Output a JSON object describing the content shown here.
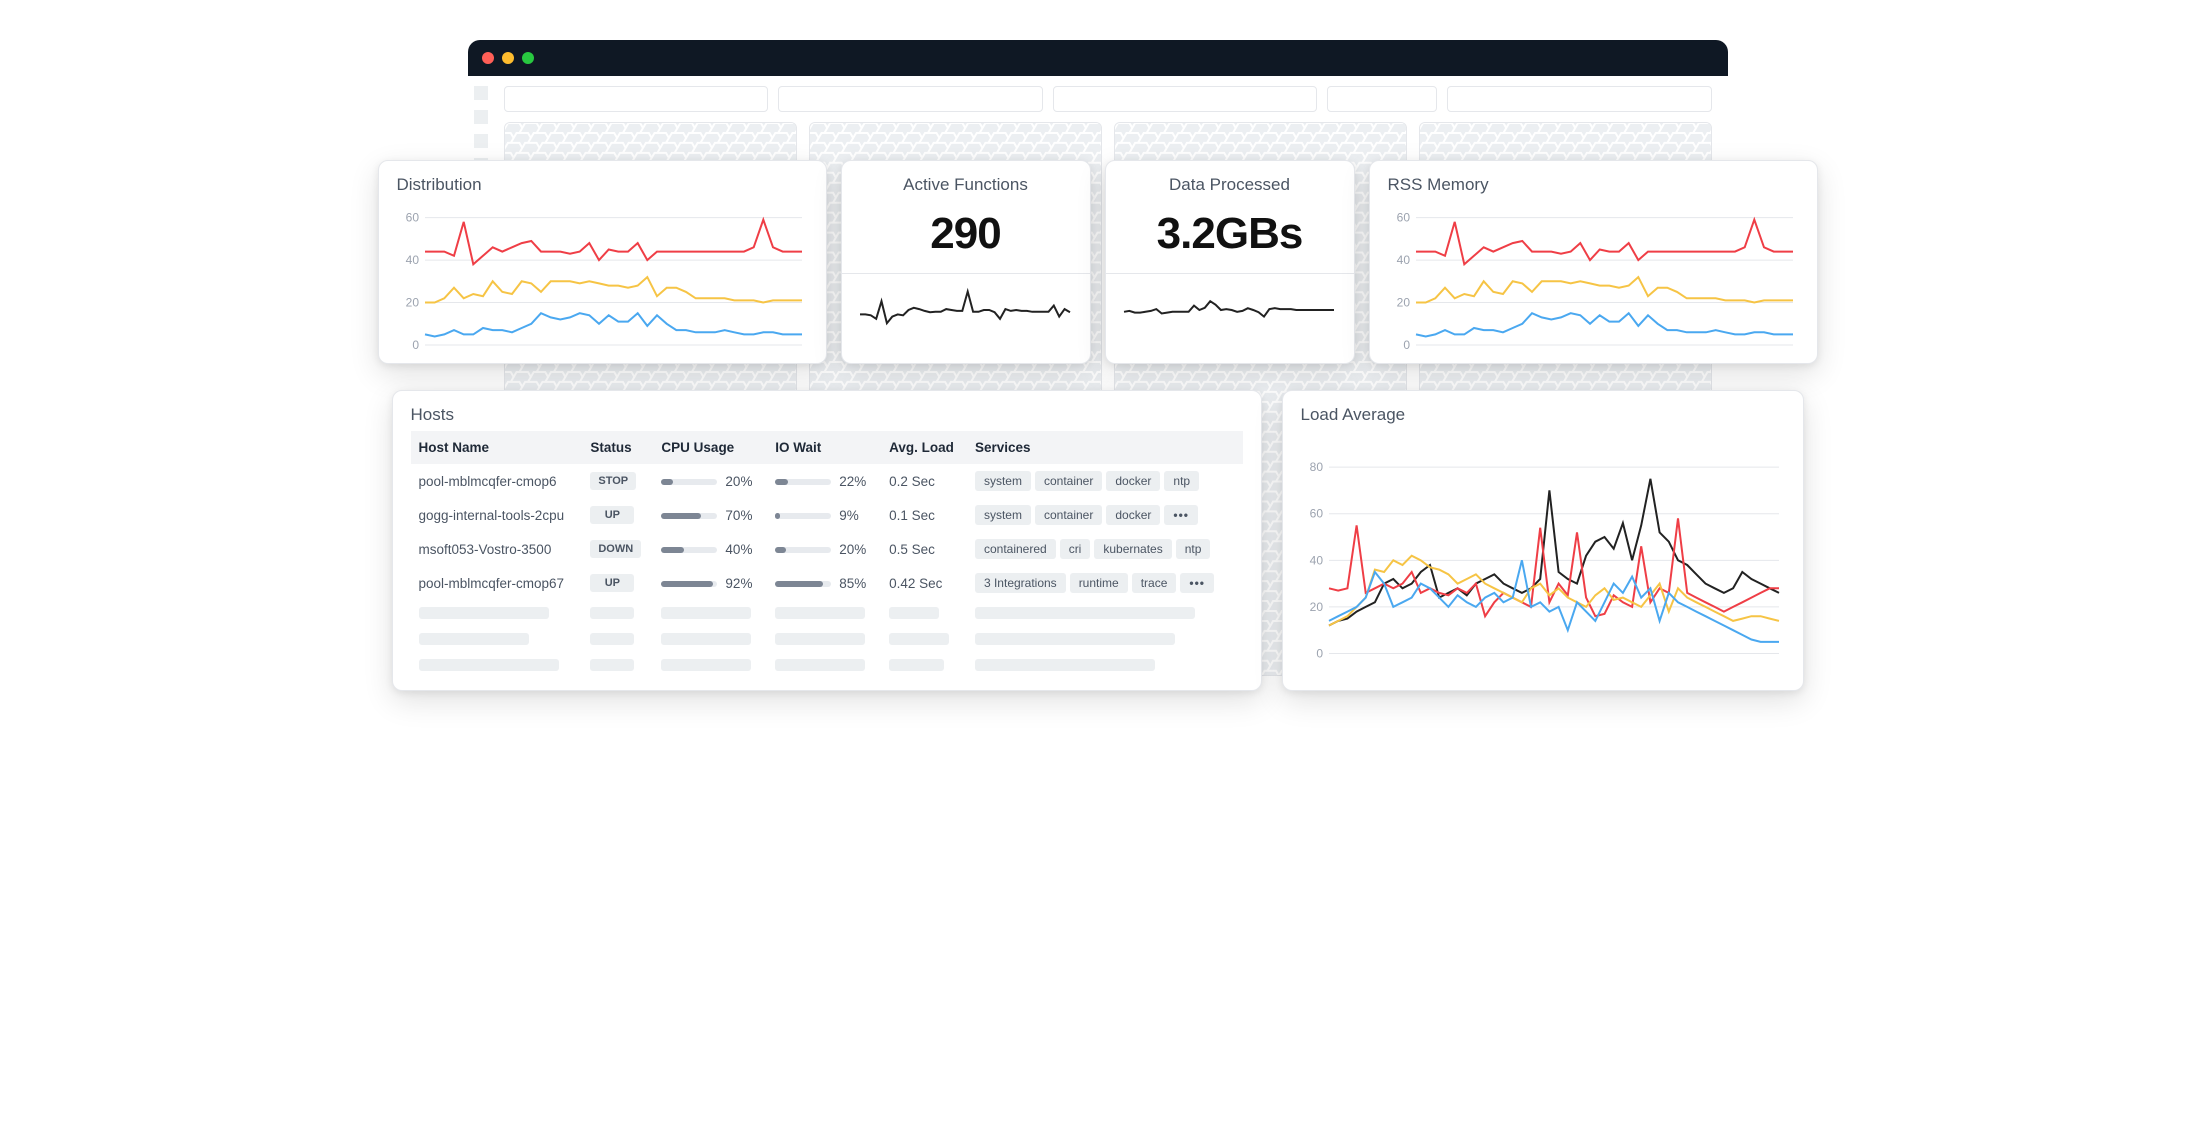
{
  "cards": {
    "distribution": {
      "title": "Distribution"
    },
    "active_functions": {
      "title": "Active Functions",
      "value": "290"
    },
    "data_processed": {
      "title": "Data Processed",
      "value": "3.2GBs"
    },
    "rss_memory": {
      "title": "RSS Memory"
    },
    "hosts": {
      "title": "Hosts",
      "columns": [
        "Host Name",
        "Status",
        "CPU Usage",
        "IO Wait",
        "Avg. Load",
        "Services"
      ],
      "rows": [
        {
          "name": "pool-mblmcqfer-cmop6",
          "status": "STOP",
          "cpu": 20,
          "io": 22,
          "avg": "0.2 Sec",
          "services": [
            "system",
            "container",
            "docker",
            "ntp"
          ],
          "more": false
        },
        {
          "name": "gogg-internal-tools-2cpu",
          "status": "UP",
          "cpu": 70,
          "io": 9,
          "avg": "0.1 Sec",
          "services": [
            "system",
            "container",
            "docker"
          ],
          "more": true
        },
        {
          "name": "msoft053-Vostro-3500",
          "status": "DOWN",
          "cpu": 40,
          "io": 20,
          "avg": "0.5 Sec",
          "services": [
            "containered",
            "cri",
            "kubernates",
            "ntp"
          ],
          "more": false
        },
        {
          "name": "pool-mblmcqfer-cmop67",
          "status": "UP",
          "cpu": 92,
          "io": 85,
          "avg": "0.42 Sec",
          "services": [
            "3 Integrations",
            "runtime",
            "trace"
          ],
          "more": true
        }
      ]
    },
    "load_average": {
      "title": "Load Average"
    }
  },
  "chart_data": [
    {
      "id": "distribution",
      "type": "line",
      "title": "Distribution",
      "ylabel": "",
      "yticks": [
        0,
        20,
        40,
        60
      ],
      "ylim": [
        0,
        65
      ],
      "x": [
        0,
        1,
        2,
        3,
        4,
        5,
        6,
        7,
        8,
        9,
        10,
        11,
        12,
        13,
        14,
        15,
        16,
        17,
        18,
        19,
        20,
        21,
        22,
        23,
        24,
        25,
        26,
        27,
        28,
        29,
        30,
        31,
        32,
        33,
        34,
        35,
        36,
        37,
        38,
        39
      ],
      "series": [
        {
          "name": "red",
          "color": "#ef3e46",
          "values": [
            44,
            44,
            44,
            42,
            58,
            38,
            42,
            46,
            44,
            46,
            48,
            49,
            44,
            44,
            44,
            43,
            44,
            48,
            40,
            45,
            44,
            44,
            48,
            40,
            44,
            44,
            44,
            44,
            44,
            44,
            44,
            44,
            44,
            44,
            46,
            59,
            46,
            44,
            44,
            44
          ]
        },
        {
          "name": "yellow",
          "color": "#f6c445",
          "values": [
            20,
            20,
            22,
            27,
            22,
            24,
            23,
            30,
            25,
            24,
            30,
            29,
            25,
            30,
            30,
            30,
            29,
            30,
            29,
            28,
            28,
            27,
            28,
            32,
            23,
            27,
            27,
            25,
            22,
            22,
            22,
            22,
            21,
            21,
            21,
            20,
            21,
            21,
            21,
            21
          ]
        },
        {
          "name": "blue",
          "color": "#4aa8f0",
          "values": [
            5,
            4,
            5,
            7,
            5,
            5,
            8,
            7,
            7,
            6,
            8,
            10,
            15,
            13,
            12,
            13,
            15,
            14,
            10,
            14,
            11,
            11,
            15,
            9,
            14,
            10,
            7,
            7,
            6,
            6,
            6,
            7,
            6,
            5,
            5,
            6,
            6,
            5,
            5,
            5
          ]
        }
      ]
    },
    {
      "id": "active_functions_spark",
      "type": "line",
      "title": "Active Functions sparkline",
      "ylim": [
        0,
        100
      ],
      "x": [
        0,
        1,
        2,
        3,
        4,
        5,
        6,
        7,
        8,
        9,
        10,
        11,
        12,
        13,
        14,
        15,
        16,
        17,
        18,
        19,
        20,
        21,
        22,
        23,
        24,
        25,
        26,
        27,
        28,
        29,
        30,
        31,
        32,
        33,
        34,
        35,
        36,
        37,
        38,
        39
      ],
      "series": [
        {
          "name": "value",
          "color": "#222",
          "values": [
            40,
            40,
            38,
            30,
            70,
            20,
            35,
            40,
            38,
            50,
            55,
            52,
            48,
            45,
            46,
            46,
            52,
            50,
            48,
            48,
            92,
            46,
            46,
            50,
            50,
            45,
            30,
            52,
            48,
            50,
            48,
            48,
            46,
            46,
            46,
            46,
            60,
            35,
            52,
            45
          ]
        }
      ]
    },
    {
      "id": "data_processed_spark",
      "type": "line",
      "title": "Data Processed sparkline",
      "ylim": [
        0,
        100
      ],
      "x": [
        0,
        1,
        2,
        3,
        4,
        5,
        6,
        7,
        8,
        9,
        10,
        11,
        12,
        13,
        14,
        15,
        16,
        17,
        18,
        19,
        20,
        21,
        22,
        23,
        24,
        25,
        26,
        27,
        28,
        29,
        30,
        31,
        32,
        33,
        34,
        35,
        36,
        37,
        38,
        39
      ],
      "series": [
        {
          "name": "value",
          "color": "#222",
          "values": [
            46,
            48,
            44,
            44,
            46,
            48,
            52,
            42,
            44,
            46,
            46,
            46,
            46,
            60,
            50,
            55,
            70,
            62,
            50,
            52,
            50,
            46,
            48,
            54,
            50,
            45,
            35,
            52,
            54,
            52,
            52,
            52,
            50,
            50,
            50,
            50,
            50,
            50,
            50,
            50
          ]
        }
      ]
    },
    {
      "id": "rss_memory",
      "type": "line",
      "title": "RSS Memory",
      "ylabel": "",
      "yticks": [
        0,
        20,
        40,
        60
      ],
      "ylim": [
        0,
        65
      ],
      "x": [
        0,
        1,
        2,
        3,
        4,
        5,
        6,
        7,
        8,
        9,
        10,
        11,
        12,
        13,
        14,
        15,
        16,
        17,
        18,
        19,
        20,
        21,
        22,
        23,
        24,
        25,
        26,
        27,
        28,
        29,
        30,
        31,
        32,
        33,
        34,
        35,
        36,
        37,
        38,
        39
      ],
      "series": [
        {
          "name": "red",
          "color": "#ef3e46",
          "values": [
            44,
            44,
            44,
            42,
            58,
            38,
            42,
            46,
            44,
            46,
            48,
            49,
            44,
            44,
            44,
            43,
            44,
            48,
            40,
            45,
            44,
            44,
            48,
            40,
            44,
            44,
            44,
            44,
            44,
            44,
            44,
            44,
            44,
            44,
            46,
            59,
            46,
            44,
            44,
            44
          ]
        },
        {
          "name": "yellow",
          "color": "#f6c445",
          "values": [
            20,
            20,
            22,
            27,
            22,
            24,
            23,
            30,
            25,
            24,
            30,
            29,
            25,
            30,
            30,
            30,
            29,
            30,
            29,
            28,
            28,
            27,
            28,
            32,
            23,
            27,
            27,
            25,
            22,
            22,
            22,
            22,
            21,
            21,
            21,
            20,
            21,
            21,
            21,
            21
          ]
        },
        {
          "name": "blue",
          "color": "#4aa8f0",
          "values": [
            5,
            4,
            5,
            7,
            5,
            5,
            8,
            7,
            7,
            6,
            8,
            10,
            15,
            13,
            12,
            13,
            15,
            14,
            10,
            14,
            11,
            11,
            15,
            9,
            14,
            10,
            7,
            7,
            6,
            6,
            6,
            7,
            6,
            5,
            5,
            6,
            6,
            5,
            5,
            5
          ]
        }
      ]
    },
    {
      "id": "load_average",
      "type": "line",
      "title": "Load Average",
      "ylabel": "",
      "yticks": [
        0,
        20,
        40,
        60,
        80
      ],
      "ylim": [
        0,
        85
      ],
      "x": [
        0,
        1,
        2,
        3,
        4,
        5,
        6,
        7,
        8,
        9,
        10,
        11,
        12,
        13,
        14,
        15,
        16,
        17,
        18,
        19,
        20,
        21,
        22,
        23,
        24,
        25,
        26,
        27,
        28,
        29,
        30,
        31,
        32,
        33,
        34,
        35,
        36,
        37,
        38,
        39,
        40,
        41,
        42,
        43,
        44,
        45,
        46,
        47,
        48,
        49
      ],
      "series": [
        {
          "name": "black",
          "color": "#222",
          "values": [
            12,
            14,
            15,
            18,
            20,
            22,
            30,
            32,
            28,
            30,
            35,
            38,
            24,
            26,
            28,
            25,
            30,
            32,
            34,
            30,
            28,
            26,
            28,
            32,
            70,
            35,
            32,
            30,
            42,
            48,
            50,
            45,
            56,
            40,
            55,
            75,
            52,
            48,
            40,
            38,
            34,
            30,
            28,
            26,
            28,
            35,
            32,
            30,
            28,
            26
          ]
        },
        {
          "name": "red",
          "color": "#ef3e46",
          "values": [
            28,
            27,
            28,
            55,
            26,
            28,
            30,
            28,
            30,
            35,
            26,
            28,
            26,
            25,
            28,
            26,
            30,
            16,
            22,
            26,
            24,
            22,
            20,
            54,
            22,
            30,
            25,
            52,
            24,
            16,
            17,
            25,
            22,
            20,
            46,
            22,
            28,
            26,
            58,
            26,
            24,
            22,
            20,
            18,
            20,
            22,
            24,
            26,
            28,
            28
          ]
        },
        {
          "name": "yellow",
          "color": "#f6c445",
          "values": [
            12,
            14,
            16,
            20,
            24,
            36,
            35,
            40,
            38,
            42,
            40,
            37,
            36,
            34,
            30,
            32,
            34,
            30,
            28,
            26,
            24,
            22,
            28,
            30,
            25,
            28,
            24,
            22,
            20,
            25,
            28,
            23,
            24,
            22,
            20,
            25,
            30,
            18,
            28,
            24,
            22,
            20,
            18,
            16,
            14,
            15,
            16,
            16,
            15,
            14
          ]
        },
        {
          "name": "blue",
          "color": "#4aa8f0",
          "values": [
            14,
            16,
            18,
            20,
            24,
            35,
            30,
            20,
            22,
            24,
            30,
            28,
            24,
            20,
            25,
            22,
            20,
            24,
            26,
            22,
            24,
            40,
            20,
            22,
            18,
            20,
            10,
            22,
            18,
            14,
            22,
            30,
            26,
            33,
            24,
            28,
            14,
            26,
            22,
            20,
            18,
            16,
            14,
            12,
            10,
            8,
            6,
            5,
            5,
            5
          ]
        }
      ]
    }
  ]
}
